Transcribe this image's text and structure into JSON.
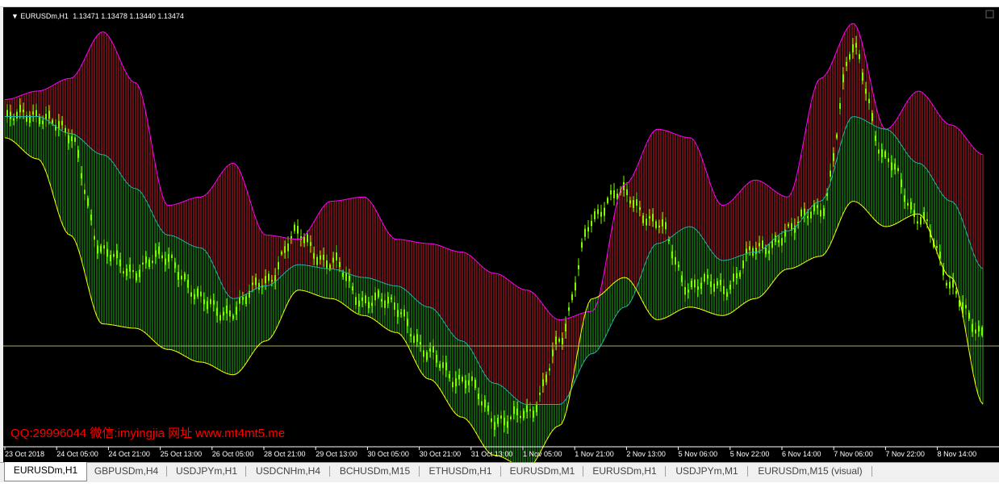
{
  "window": {
    "symbol_info": "EURUSDm,H1",
    "ohlc_text": "1.13471 1.13478 1.13440 1.13474",
    "watermark": "QQ:29996044 微信:imyingjia 网址 www.mt4mt5.me",
    "colors": {
      "background": "#000000",
      "upper_band": "#ff00ff",
      "middle_band": "#20b2aa",
      "lower_band": "#ffff00",
      "upper_fill": "#cc1f2d",
      "lower_fill": "#1fae1a",
      "candles": "#7cfc00",
      "price_line": "#aaaa66",
      "watermark": "#ff0000",
      "text": "#ffffff"
    }
  },
  "chart_data": {
    "type": "line",
    "y_label_note": "",
    "x_ticks": [
      "23 Oct 2018",
      "24 Oct 05:00",
      "24 Oct 21:00",
      "25 Oct 13:00",
      "26 Oct 05:00",
      "28 Oct 21:00",
      "29 Oct 13:00",
      "30 Oct 05:00",
      "30 Oct 21:00",
      "31 Oct 13:00",
      "1 Nov 05:00",
      "1 Nov 21:00",
      "2 Nov 13:00",
      "5 Nov 06:00",
      "5 Nov 22:00",
      "6 Nov 14:00",
      "7 Nov 06:00",
      "7 Nov 22:00",
      "8 Nov 14:00"
    ],
    "ylim": [
      0,
      1
    ],
    "current_price_level": 0.238,
    "series": [
      {
        "role": "upper",
        "values": [
          0.82,
          0.84,
          0.87,
          0.98,
          0.86,
          0.57,
          0.59,
          0.67,
          0.5,
          0.49,
          0.58,
          0.59,
          0.49,
          0.48,
          0.46,
          0.41,
          0.37,
          0.3,
          0.32,
          0.62,
          0.75,
          0.73,
          0.57,
          0.63,
          0.59,
          0.87,
          1.0,
          0.75,
          0.84,
          0.76,
          0.69
        ]
      },
      {
        "role": "middle",
        "values": [
          0.78,
          0.78,
          0.74,
          0.69,
          0.61,
          0.5,
          0.47,
          0.35,
          0.38,
          0.43,
          0.42,
          0.4,
          0.38,
          0.33,
          0.25,
          0.15,
          0.1,
          0.1,
          0.22,
          0.33,
          0.48,
          0.52,
          0.44,
          0.46,
          0.51,
          0.58,
          0.78,
          0.75,
          0.67,
          0.58,
          0.42
        ]
      },
      {
        "role": "lower",
        "values": [
          0.73,
          0.68,
          0.5,
          0.29,
          0.28,
          0.23,
          0.2,
          0.17,
          0.25,
          0.37,
          0.35,
          0.31,
          0.27,
          0.16,
          0.07,
          -0.02,
          -0.05,
          0.05,
          0.35,
          0.4,
          0.3,
          0.33,
          0.31,
          0.35,
          0.42,
          0.45,
          0.58,
          0.52,
          0.55,
          0.4,
          0.1
        ]
      },
      {
        "role": "price",
        "values": [
          0.77,
          0.79,
          0.73,
          0.45,
          0.42,
          0.45,
          0.34,
          0.32,
          0.4,
          0.5,
          0.43,
          0.35,
          0.33,
          0.21,
          0.16,
          0.07,
          0.07,
          0.25,
          0.55,
          0.6,
          0.52,
          0.38,
          0.38,
          0.46,
          0.51,
          0.57,
          0.94,
          0.67,
          0.55,
          0.38,
          0.25
        ]
      }
    ]
  },
  "tabs": [
    {
      "label": "EURUSDm,H1",
      "active": true
    },
    {
      "label": "GBPUSDm,H4",
      "active": false
    },
    {
      "label": "USDJPYm,H1",
      "active": false
    },
    {
      "label": "USDCNHm,H4",
      "active": false
    },
    {
      "label": "BCHUSDm,M15",
      "active": false
    },
    {
      "label": "ETHUSDm,H1",
      "active": false
    },
    {
      "label": "EURUSDm,M1",
      "active": false
    },
    {
      "label": "EURUSDm,H1",
      "active": false
    },
    {
      "label": "USDJPYm,M1",
      "active": false
    },
    {
      "label": "EURUSDm,M15 (visual)",
      "active": false
    }
  ]
}
